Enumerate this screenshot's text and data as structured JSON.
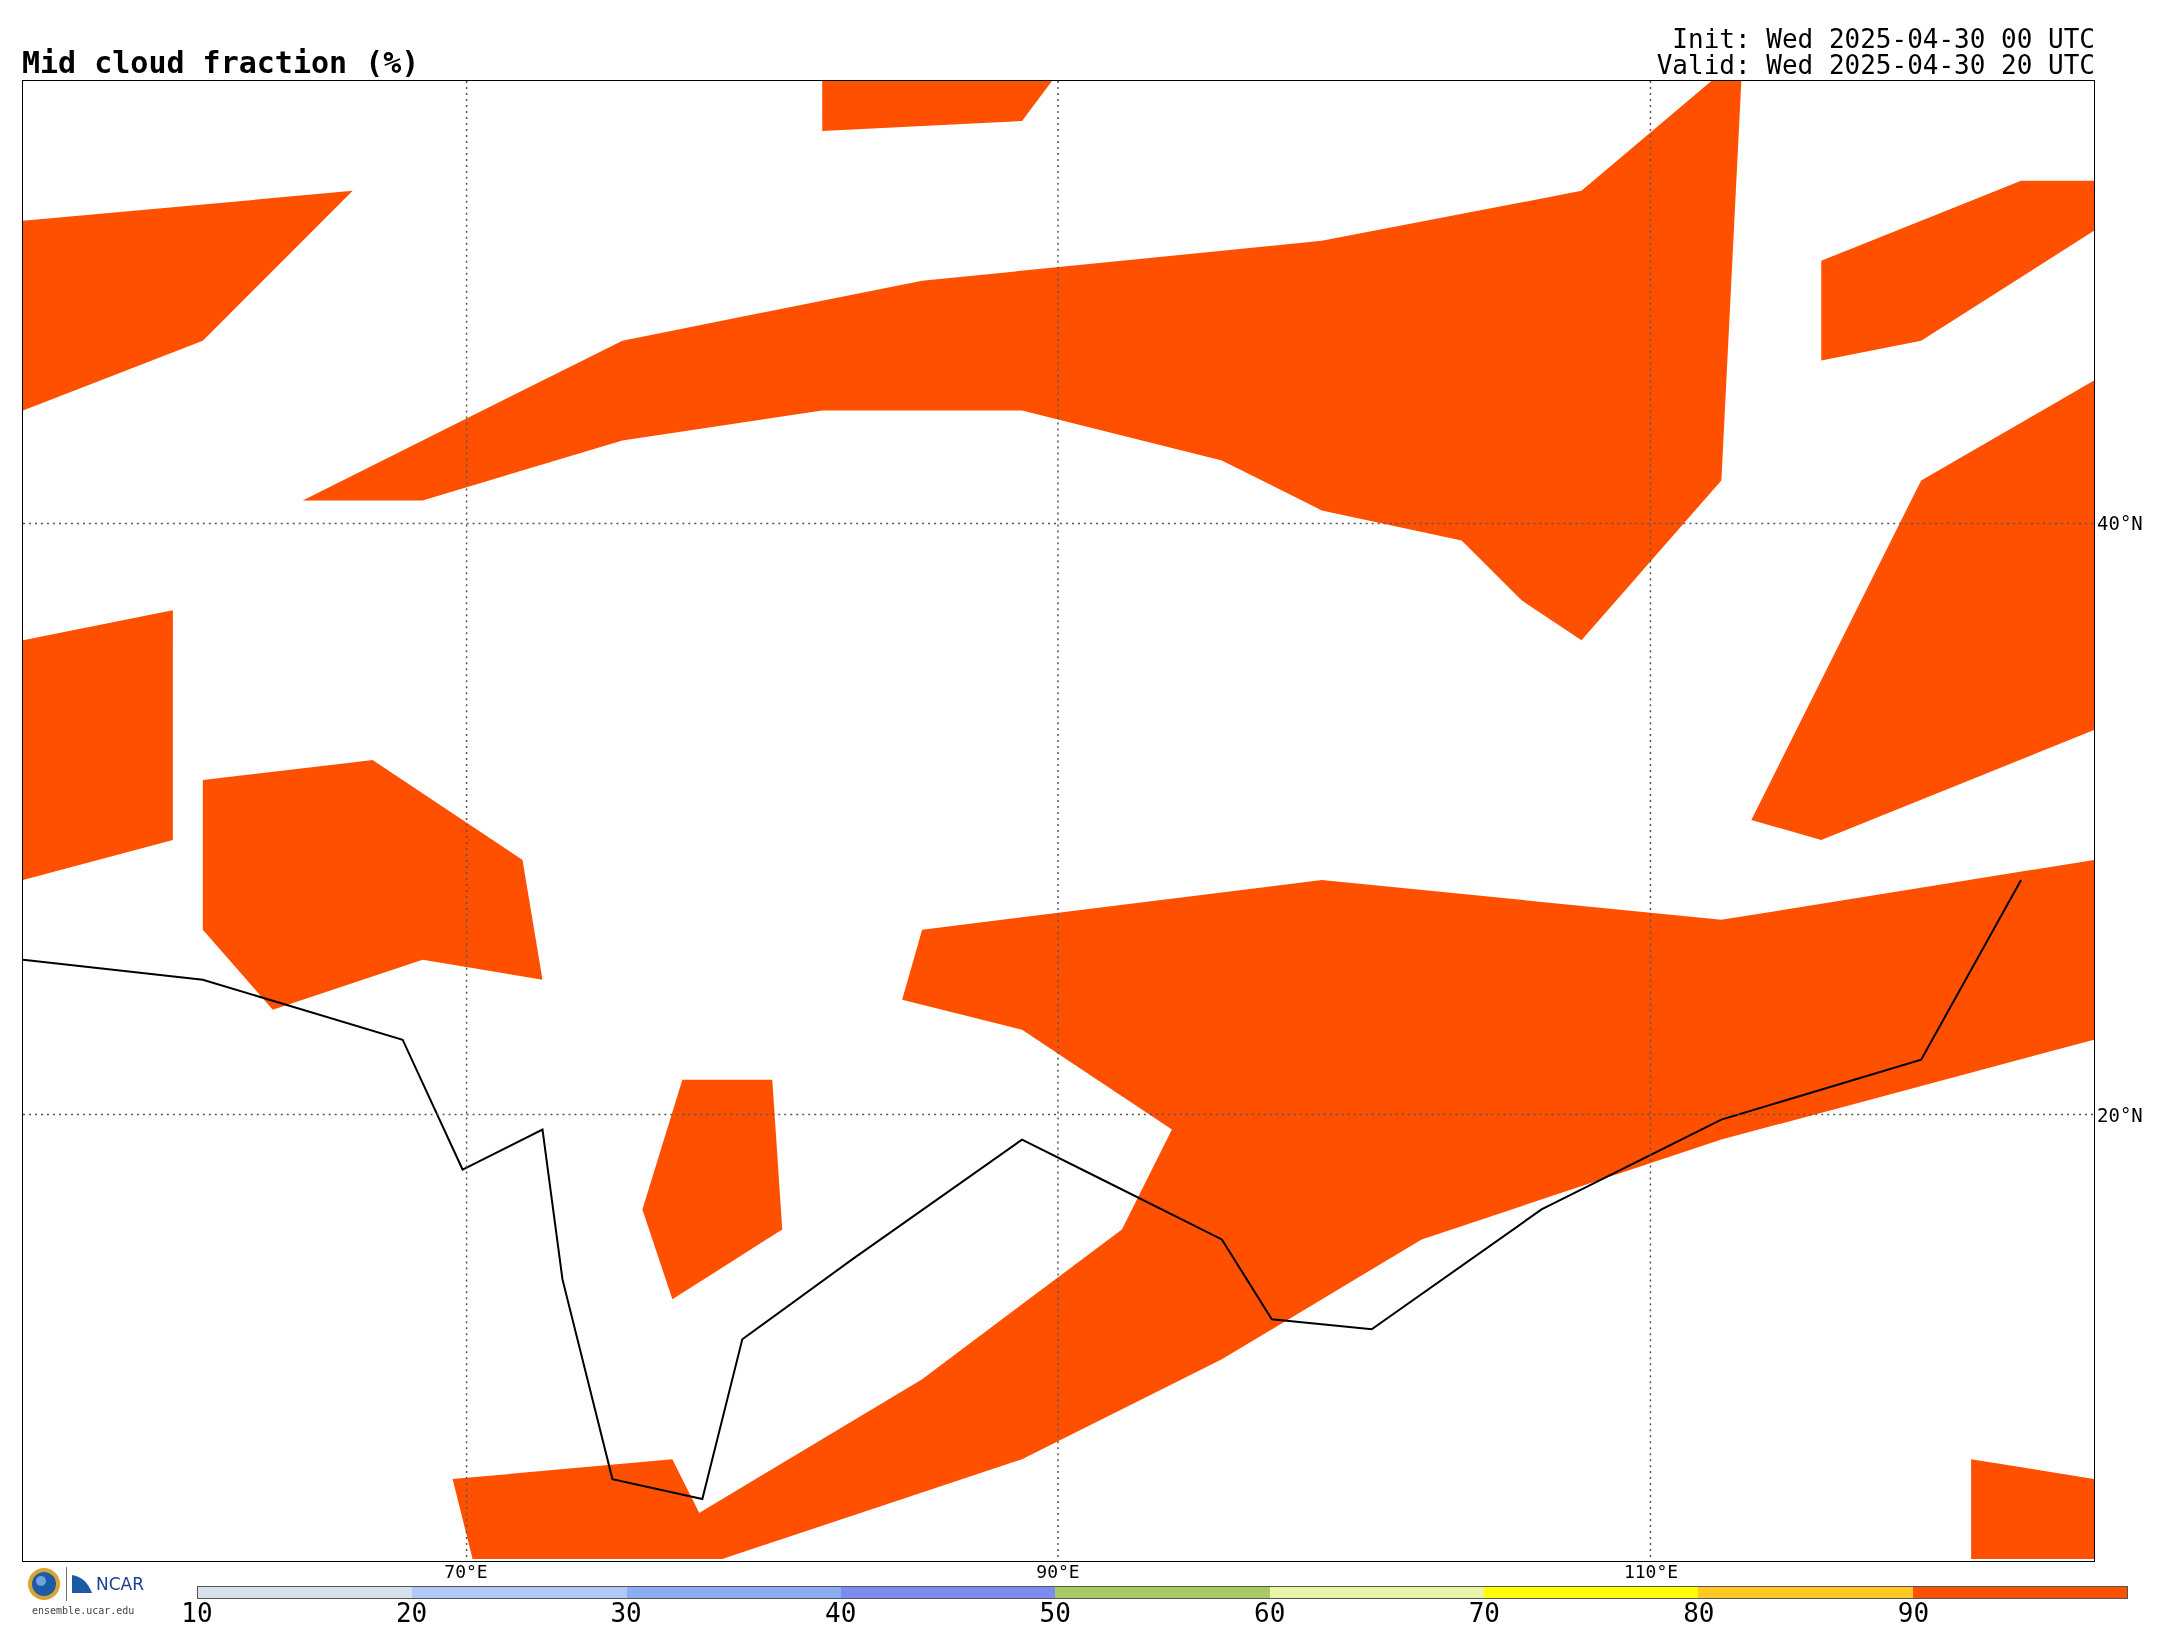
{
  "title": "Mid cloud fraction (%)",
  "times": [
    "Init: Wed 2025-04-30 00 UTC",
    "Valid: Wed 2025-04-30 20 UTC"
  ],
  "map": {
    "lat_labels": [
      "40°N",
      "20°N"
    ],
    "lon_labels": [
      "70°E",
      "90°E",
      "110°E"
    ]
  },
  "logos": {
    "brand": "NCAR",
    "site": "ensemble.ucar.edu"
  },
  "colorbar": {
    "ticks": [
      "10",
      "20",
      "30",
      "40",
      "50",
      "60",
      "70",
      "80",
      "90"
    ],
    "segments": [
      {
        "color": "#d8e2ec"
      },
      {
        "color": "#b3c8f6"
      },
      {
        "color": "#8badf2"
      },
      {
        "color": "#7a8cf0"
      },
      {
        "color": "#a6cb62"
      },
      {
        "color": "#e8f5a4"
      },
      {
        "color": "#ffff00"
      },
      {
        "color": "#ffc822"
      },
      {
        "color": "#ff5000"
      }
    ]
  }
}
